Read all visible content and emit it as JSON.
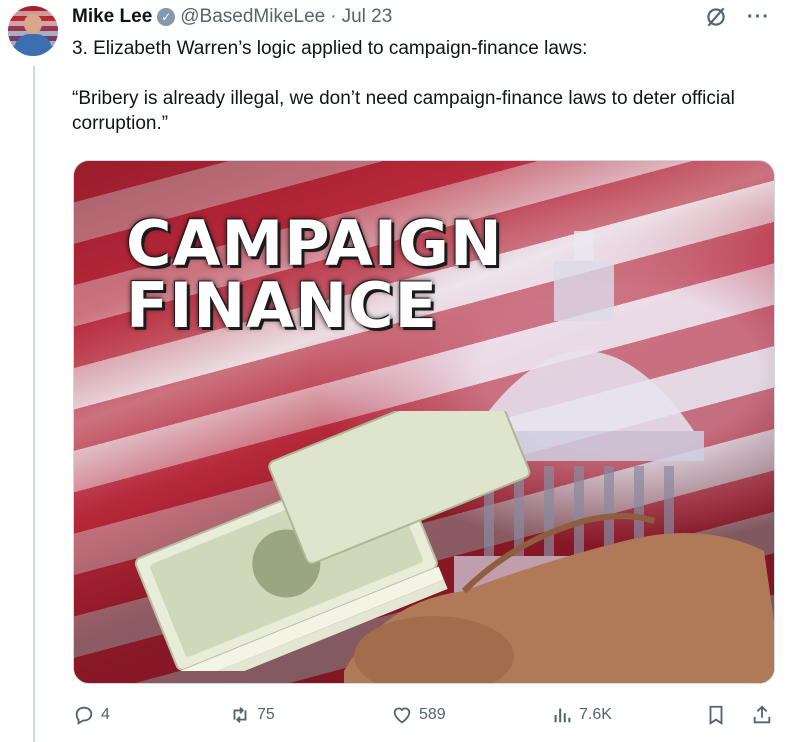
{
  "tweet": {
    "author_name": "Mike Lee",
    "handle": "@BasedMikeLee",
    "separator": "·",
    "date": "Jul 23",
    "text": "3. Elizabeth Warren’s logic applied to campaign-finance laws:\n\n“Bribery is already illegal, we don’t need campaign-finance laws to deter official corruption.”"
  },
  "media": {
    "caption_line1": "CAMPAIGN",
    "caption_line2": "FINANCE"
  },
  "actions": {
    "reply_count": "4",
    "retweet_count": "75",
    "like_count": "589",
    "view_count": "7.6K"
  },
  "icons": {
    "verified": "verified-badge-icon",
    "grok": "grok-slash-icon",
    "more": "more-icon",
    "reply": "reply-icon",
    "retweet": "retweet-icon",
    "like": "heart-icon",
    "views": "views-icon",
    "bookmark": "bookmark-icon",
    "share": "share-icon"
  },
  "colors": {
    "text": "#0f1419",
    "secondary": "#536471",
    "border": "#cfd9de",
    "verified_gray": "#829aab"
  }
}
